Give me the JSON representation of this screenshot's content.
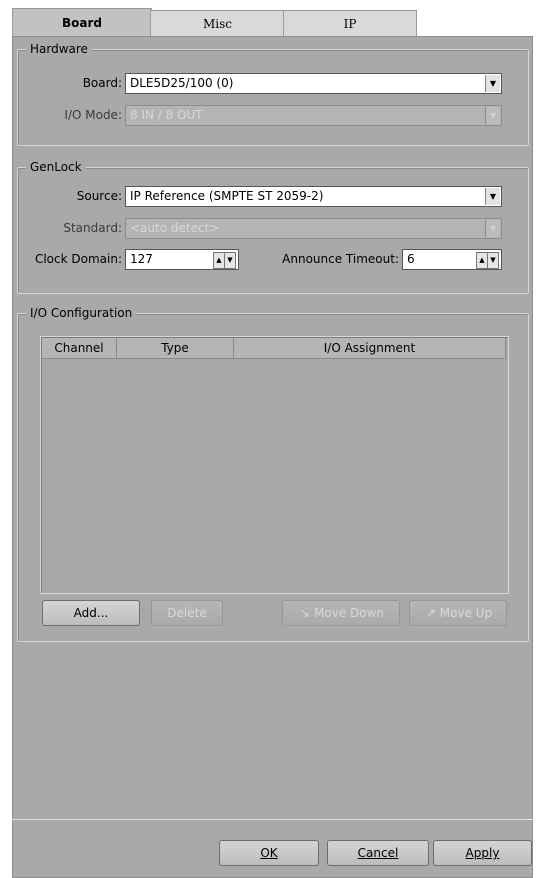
{
  "tabs": [
    {
      "label": "Board",
      "active": true
    },
    {
      "label": "Misc",
      "active": false
    },
    {
      "label": "IP",
      "active": false
    }
  ],
  "hardware": {
    "legend": "Hardware",
    "board_label": "Board:",
    "board_value": "DLE5D25/100 (0)",
    "io_mode_label": "I/O Mode:",
    "io_mode_value": "8 IN / 8 OUT"
  },
  "genlock": {
    "legend": "GenLock",
    "source_label": "Source:",
    "source_value": "IP Reference (SMPTE ST 2059-2)",
    "standard_label": "Standard:",
    "standard_value": "<auto detect>",
    "clock_domain_label": "Clock Domain:",
    "clock_domain_value": "127",
    "announce_timeout_label": "Announce Timeout:",
    "announce_timeout_value": "6"
  },
  "io_config": {
    "legend": "I/O Configuration",
    "columns": [
      "Channel",
      "Type",
      "I/O Assignment"
    ],
    "add_label": "Add...",
    "delete_label": "Delete",
    "move_down_label": "Move Down",
    "move_up_label": "Move Up"
  },
  "footer": {
    "ok_label": "OK",
    "cancel_label": "Cancel",
    "apply_label": "Apply"
  }
}
